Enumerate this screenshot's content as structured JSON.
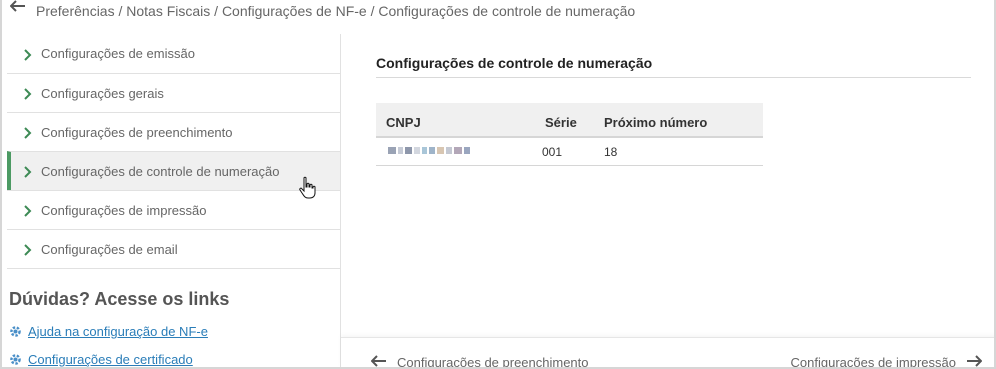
{
  "breadcrumb": {
    "text": "Preferências / Notas Fiscais / Configurações de NF-e / Configurações de controle de numeração"
  },
  "sidebar": {
    "items": [
      {
        "label": "Configurações de emissão"
      },
      {
        "label": "Configurações gerais"
      },
      {
        "label": "Configurações de preenchimento"
      },
      {
        "label": "Configurações de controle de numeração",
        "active": true
      },
      {
        "label": "Configurações de impressão"
      },
      {
        "label": "Configurações de email"
      }
    ],
    "help_title": "Dúvidas? Acesse os links",
    "links": [
      {
        "label": "Ajuda na configuração de NF-e",
        "icon": "gear-icon"
      },
      {
        "label": "Configurações de certificado",
        "icon": "gear-icon"
      }
    ]
  },
  "main": {
    "title": "Configurações de controle de numeração",
    "table": {
      "headers": [
        "CNPJ",
        "Série",
        "Próximo número"
      ],
      "rows": [
        {
          "cnpj": "",
          "serie": "001",
          "proximo": "18"
        }
      ]
    }
  },
  "footer": {
    "prev_label": "Configurações de preenchimento",
    "next_label": "Configurações de impressão"
  },
  "colors": {
    "accent": "#4c9a63",
    "link": "#2a7db8"
  }
}
